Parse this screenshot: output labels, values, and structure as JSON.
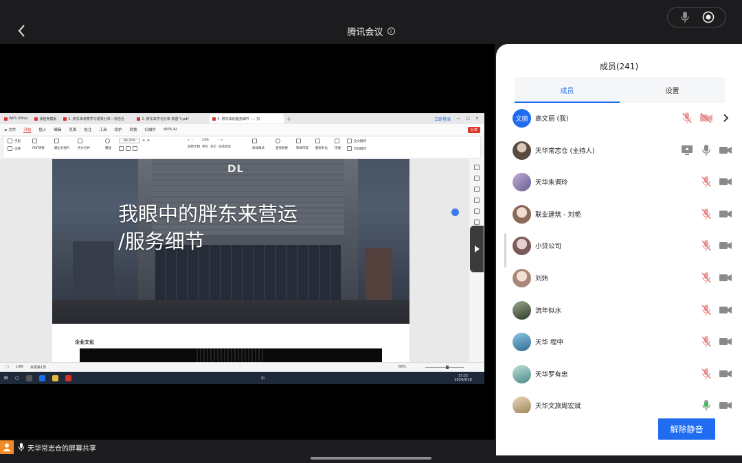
{
  "meeting": {
    "title": "腾讯会议",
    "info_icon": "i"
  },
  "share_status": "天华常志仓的屏幕共享",
  "colors": {
    "accent": "#1f6cf0",
    "orange": "#f28b25",
    "muted_red": "#d9342b"
  },
  "wps": {
    "tabs": [
      {
        "label": "WPS Office",
        "active": false
      },
      {
        "label": "找稻壳模板",
        "active": false
      },
      {
        "label": "5. 胖东来考察学习成果分享---常志仓",
        "active": false
      },
      {
        "label": "2. 胖东来学习分享-李晋飞.pdf",
        "active": false
      },
      {
        "label": "4. 胖东来的服务细节 ---- 刘",
        "active": true
      }
    ],
    "tab_plus": "+",
    "login_btn": "立即登录",
    "menu": [
      "≡ 文件",
      "开始",
      "插入",
      "编辑",
      "页面",
      "批注",
      "工具",
      "保护",
      "转换",
      "扫描件",
      "WPS AI"
    ],
    "menu_active_index": 1,
    "share_label": "分享",
    "ribbon": {
      "hand": "手型",
      "select": "选择",
      "pdf_convert": "PDF转换",
      "export_img": "输出为图片",
      "split_merge": "拆分合并",
      "play": "播放",
      "zoom": "88.35%",
      "page": "1/66",
      "rotate": "旋转文档",
      "single": "单页",
      "double": "双页",
      "continuous": "连续阅读",
      "read_mode": "阅读模式",
      "find": "查找替换",
      "translate": "全文翻译",
      "review": "审阅内容",
      "crop": "截图对比",
      "compress": "压缩",
      "translate_word": "划词翻译"
    },
    "status": {
      "page": "1/66",
      "total": "目录第1页",
      "zoom": "88%"
    },
    "taskbar": {
      "time": "15:22",
      "date": "2024/9/16",
      "lang": "中"
    }
  },
  "document": {
    "cover_title": "我眼中的胖东来营运\n/服务细节",
    "logo": "DL",
    "section": "企业文化"
  },
  "panel": {
    "title": "成员(241)",
    "tabs": [
      "成员",
      "设置"
    ],
    "active_tab": 0,
    "unmute_label": "解除静音",
    "members": [
      {
        "name": "高文丽 (我)",
        "avatar_text": "文丽",
        "avatar_color": "#1f6cf0",
        "mic": "muted-red",
        "video": "off-red",
        "extra": "chevron"
      },
      {
        "name": "天华常志仓 (主持人)",
        "avatar_text": "",
        "avatar_color": "#6b5a4e",
        "mic": "on-gray",
        "video": "on-gray",
        "extra": "screen-share"
      },
      {
        "name": "天华朱调玲",
        "avatar_text": "",
        "avatar_color": "#8a7aa8",
        "mic": "muted-red",
        "video": "on-gray",
        "extra": ""
      },
      {
        "name": "联业建筑 - 刘艳",
        "avatar_text": "",
        "avatar_color": "#c9a28e",
        "mic": "muted-red",
        "video": "on-gray",
        "extra": ""
      },
      {
        "name": "小贷公司",
        "avatar_text": "",
        "avatar_color": "#b99a9a",
        "mic": "muted-red",
        "video": "on-gray",
        "extra": ""
      },
      {
        "name": "刘炜",
        "avatar_text": "",
        "avatar_color": "#d8b8a8",
        "mic": "muted-red",
        "video": "on-gray",
        "extra": ""
      },
      {
        "name": "流年似水",
        "avatar_text": "",
        "avatar_color": "#4a5a48",
        "mic": "muted-red",
        "video": "on-gray",
        "extra": ""
      },
      {
        "name": "天华 程中",
        "avatar_text": "",
        "avatar_color": "#4f8fb5",
        "mic": "muted-red",
        "video": "on-gray",
        "extra": ""
      },
      {
        "name": "天华罗有忠",
        "avatar_text": "",
        "avatar_color": "#6aa0a0",
        "mic": "muted-red",
        "video": "on-gray",
        "extra": ""
      },
      {
        "name": "天华文旅周宏斌",
        "avatar_text": "",
        "avatar_color": "#b8a078",
        "mic": "on-green",
        "video": "on-gray",
        "extra": ""
      }
    ]
  }
}
